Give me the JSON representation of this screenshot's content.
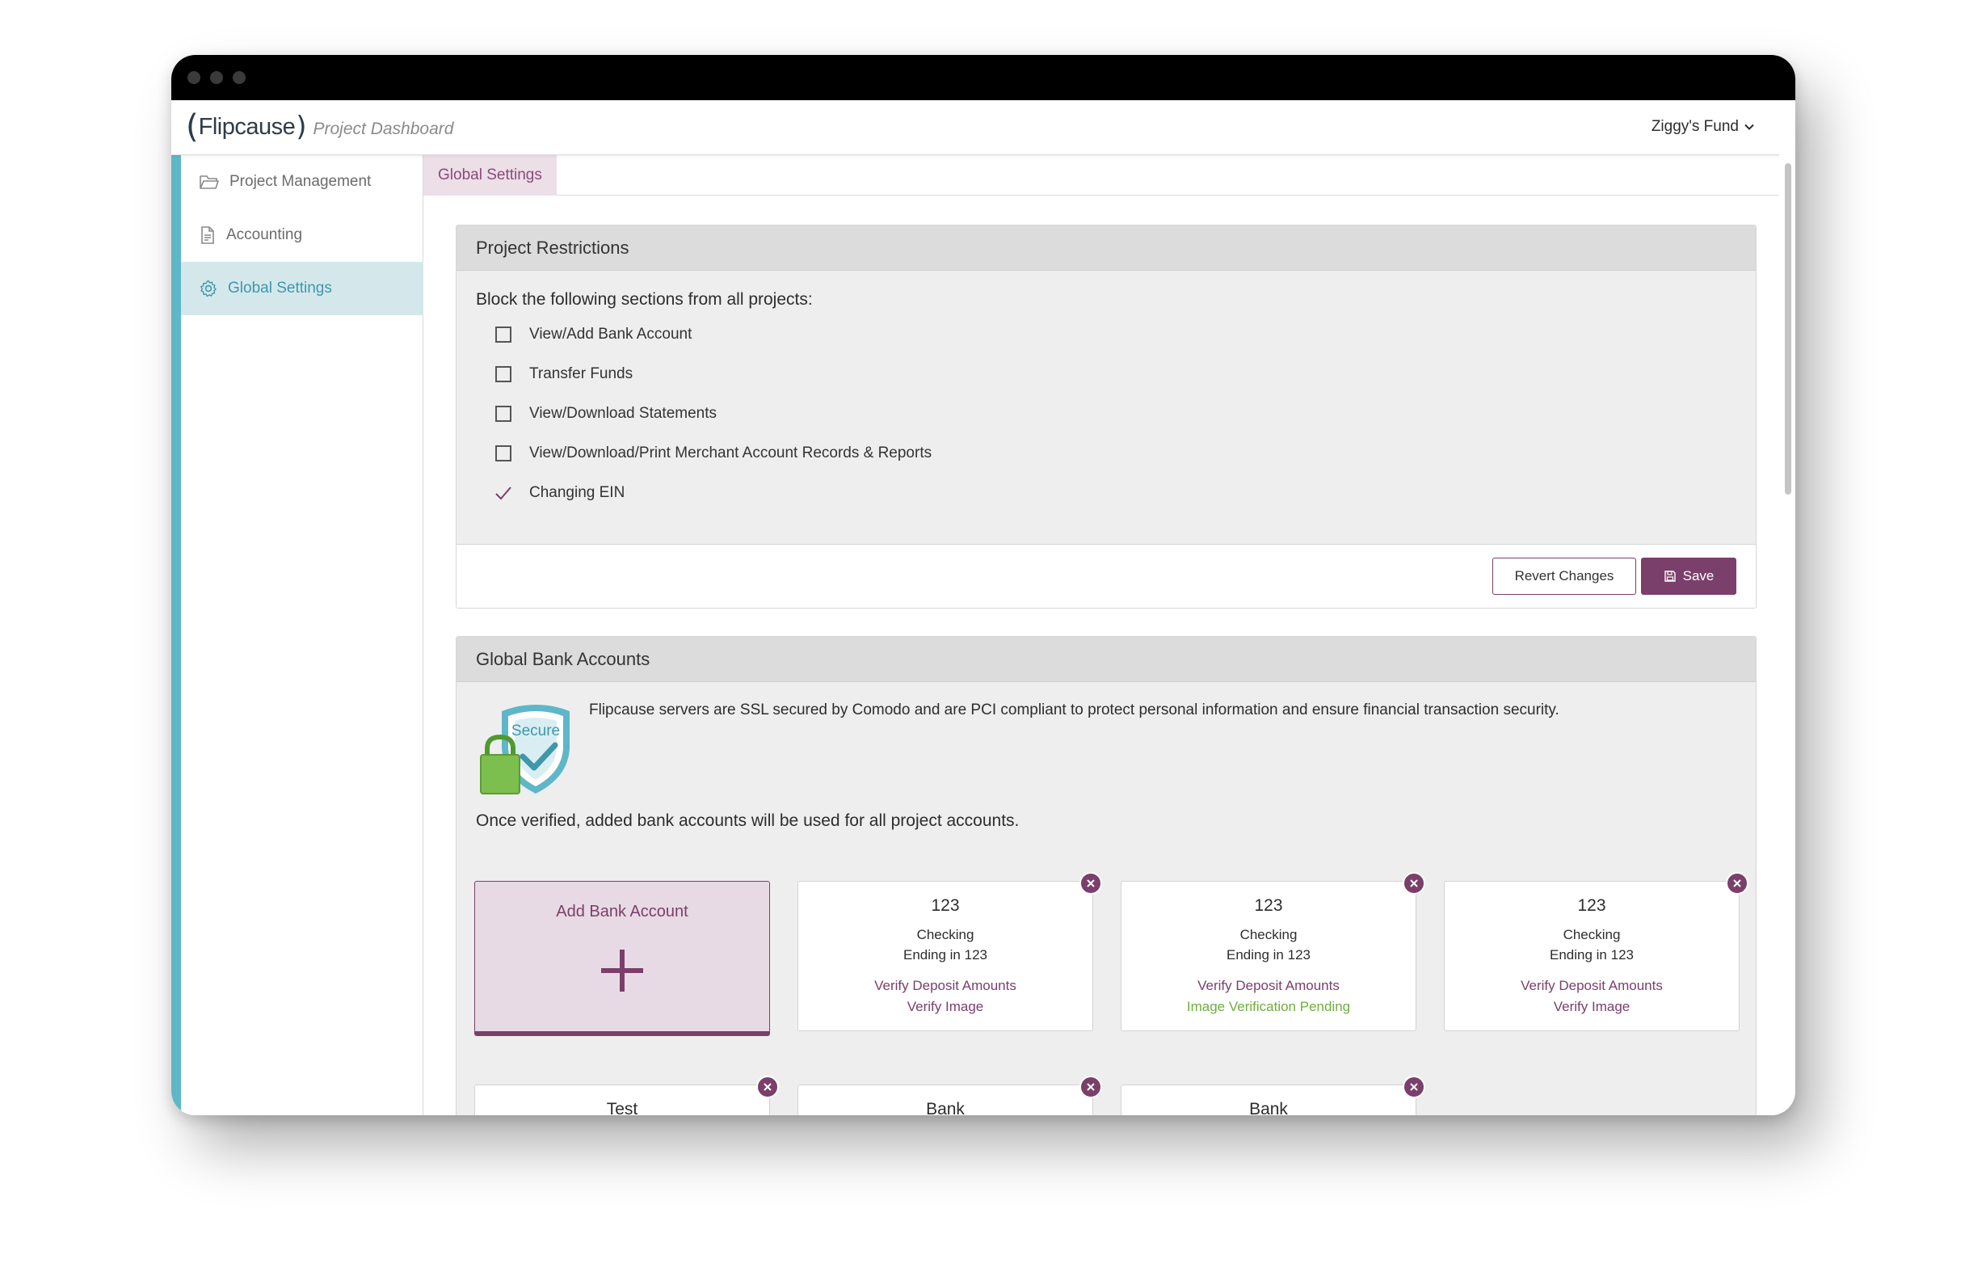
{
  "colors": {
    "accent": "#7a3f6b",
    "teal": "#5eb7c8",
    "pending": "#6fae3e"
  },
  "header": {
    "logo_text": "Flipcause",
    "subtitle": "Project Dashboard",
    "user_menu": "Ziggy's Fund"
  },
  "sidebar": {
    "items": [
      {
        "label": "Project Management",
        "icon": "folder-icon"
      },
      {
        "label": "Accounting",
        "icon": "document-icon"
      },
      {
        "label": "Global Settings",
        "icon": "gear-icon",
        "active": true
      }
    ]
  },
  "tabs": [
    {
      "label": "Global Settings",
      "active": true
    }
  ],
  "restrictions": {
    "title": "Project Restrictions",
    "instruction": "Block the following sections from all projects:",
    "options": [
      {
        "label": "View/Add Bank Account",
        "checked": false
      },
      {
        "label": "Transfer Funds",
        "checked": false
      },
      {
        "label": "View/Download Statements",
        "checked": false
      },
      {
        "label": "View/Download/Print Merchant Account Records & Reports",
        "checked": false
      },
      {
        "label": "Changing EIN",
        "checked": true
      }
    ],
    "revert_label": "Revert Changes",
    "save_label": "Save"
  },
  "bank_accounts": {
    "title": "Global Bank Accounts",
    "badge_text": "Secure",
    "security_text": "Flipcause servers are SSL secured by Comodo and are PCI compliant to protect personal information and ensure financial transaction security.",
    "verified_text": "Once verified, added bank accounts will be used for all project accounts.",
    "add_label": "Add Bank Account",
    "accounts": [
      {
        "name": "123",
        "type": "Checking",
        "ending": "Ending in 123",
        "link1": "Verify Deposit Amounts",
        "link2": "Verify Image"
      },
      {
        "name": "123",
        "type": "Checking",
        "ending": "Ending in 123",
        "link1": "Verify Deposit Amounts",
        "link2": "Image Verification Pending"
      },
      {
        "name": "123",
        "type": "Checking",
        "ending": "Ending in 123",
        "link1": "Verify Deposit Amounts",
        "link2": "Verify Image"
      },
      {
        "name": "Test"
      },
      {
        "name": "Bank"
      },
      {
        "name": "Bank"
      }
    ]
  }
}
